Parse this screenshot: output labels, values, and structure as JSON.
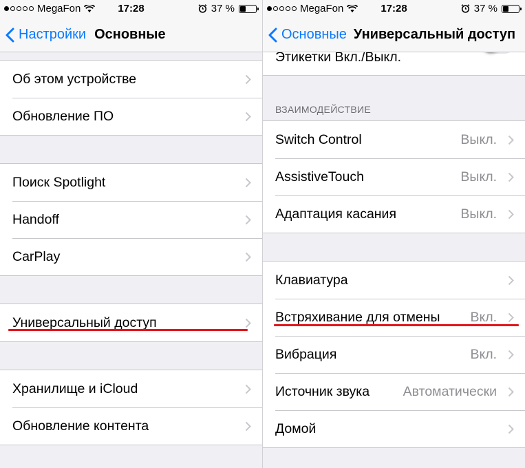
{
  "left": {
    "status": {
      "carrier": "MegaFon",
      "time": "17:28",
      "battery": "37 %",
      "battery_fraction": 0.37
    },
    "nav": {
      "back_label": "Настройки",
      "title": "Основные"
    },
    "groups": [
      [
        "Об этом устройстве",
        "Обновление ПО"
      ],
      [
        "Поиск Spotlight",
        "Handoff",
        "CarPlay"
      ],
      [
        "Универсальный доступ"
      ],
      [
        "Хранилище и iCloud",
        "Обновление контента"
      ]
    ]
  },
  "right": {
    "status": {
      "carrier": "MegaFon",
      "time": "17:28",
      "battery": "37 %",
      "battery_fraction": 0.37
    },
    "nav": {
      "back_label": "Основные",
      "title": "Универсальный доступ"
    },
    "partial_row": {
      "label": "Этикетки Вкл./Выкл.",
      "toggle_on": false
    },
    "section_header": "ВЗАИМОДЕЙСТВИЕ",
    "interaction": [
      {
        "label": "Switch Control",
        "value": "Выкл."
      },
      {
        "label": "AssistiveTouch",
        "value": "Выкл."
      },
      {
        "label": "Адаптация касания",
        "value": "Выкл."
      }
    ],
    "other": [
      {
        "label": "Клавиатура",
        "value": ""
      },
      {
        "label": "Встряхивание для отмены",
        "value": "Вкл."
      },
      {
        "label": "Вибрация",
        "value": "Вкл."
      },
      {
        "label": "Источник звука",
        "value": "Автоматически"
      },
      {
        "label": "Домой",
        "value": ""
      }
    ]
  },
  "colors": {
    "accent": "#0a7aff",
    "highlight": "#e3161e",
    "secondary_text": "#8e8e93",
    "background": "#efeff4"
  }
}
